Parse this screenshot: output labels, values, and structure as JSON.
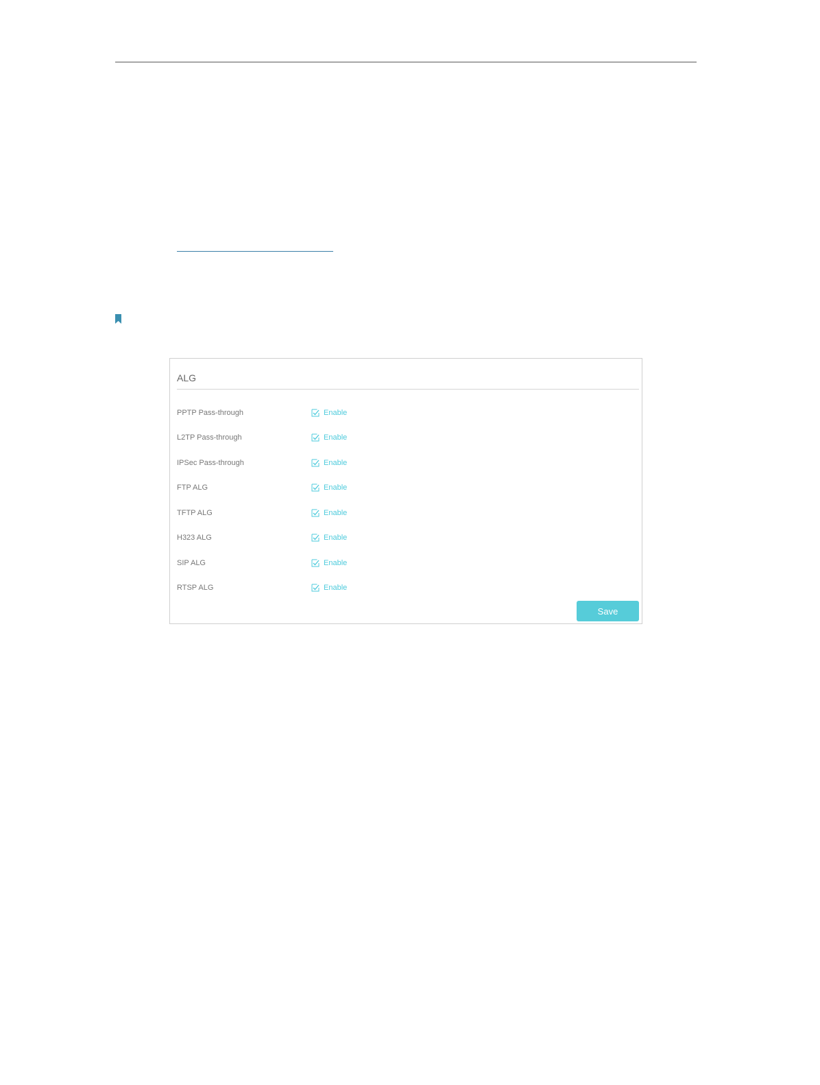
{
  "alg_panel": {
    "title": "ALG",
    "rows": [
      {
        "label": "PPTP Pass-through",
        "enable_label": "Enable",
        "checked": true
      },
      {
        "label": "L2TP Pass-through",
        "enable_label": "Enable",
        "checked": true
      },
      {
        "label": "IPSec Pass-through",
        "enable_label": "Enable",
        "checked": true
      },
      {
        "label": "FTP ALG",
        "enable_label": "Enable",
        "checked": true
      },
      {
        "label": "TFTP ALG",
        "enable_label": "Enable",
        "checked": true
      },
      {
        "label": "H323 ALG",
        "enable_label": "Enable",
        "checked": true
      },
      {
        "label": "SIP ALG",
        "enable_label": "Enable",
        "checked": true
      },
      {
        "label": "RTSP ALG",
        "enable_label": "Enable",
        "checked": true
      }
    ],
    "save_label": "Save"
  },
  "colors": {
    "accent": "#56ccd9",
    "enable_text": "#4ecbdc",
    "link": "#3a7fa8",
    "bookmark": "#3a8fb0"
  }
}
